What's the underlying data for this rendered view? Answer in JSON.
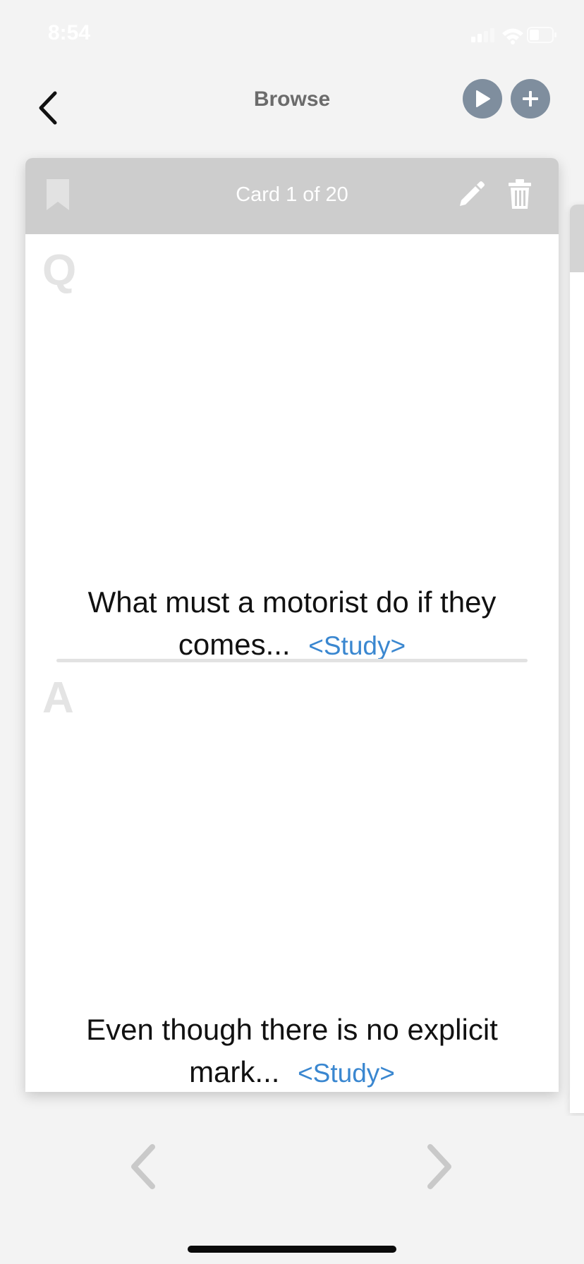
{
  "status_bar": {
    "time": "8:54"
  },
  "nav": {
    "title": "Browse",
    "icons": {
      "back": "chevron-left-icon",
      "play": "play-icon",
      "add": "plus-icon"
    }
  },
  "card": {
    "counter": "Card 1 of 20",
    "icons": {
      "bookmark": "bookmark-icon",
      "edit": "pencil-icon",
      "delete": "trash-icon"
    },
    "question": {
      "letter": "Q",
      "text": "What must a motorist do if they comes...",
      "study_link": "<Study>"
    },
    "answer": {
      "letter": "A",
      "text": "Even though there is no explicit mark...",
      "study_link": "<Study>"
    }
  },
  "footer": {
    "icons": {
      "previous": "chevron-left-icon",
      "next": "chevron-right-icon"
    }
  },
  "colors": {
    "background": "#f3f3f3",
    "card_header": "#cdcdcd",
    "circle_button": "#7f8e9e",
    "link": "#3a87d0"
  }
}
